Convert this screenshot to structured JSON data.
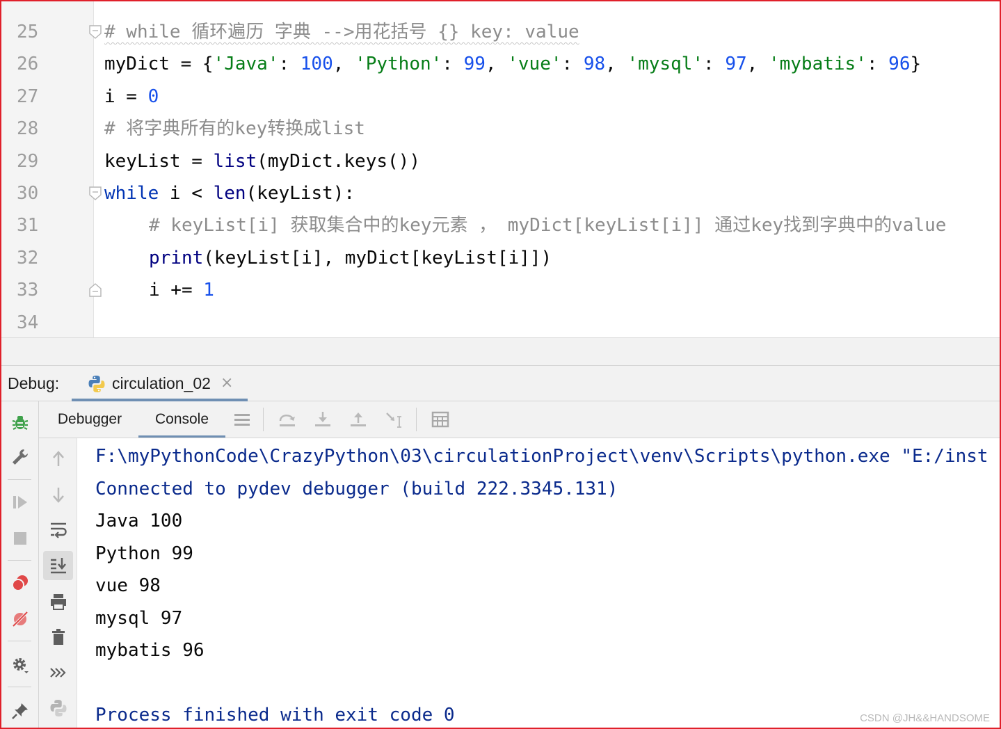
{
  "editor": {
    "lines": [
      {
        "no": "25",
        "indent": 0,
        "fold": "open",
        "tokens": [
          {
            "t": "# while 循环遍历 字典 -->用花括号 {} key: value",
            "c": "cm cmt-under"
          }
        ]
      },
      {
        "no": "26",
        "indent": 0,
        "tokens": [
          {
            "t": "myDict = {"
          },
          {
            "t": "'Java'",
            "c": "st"
          },
          {
            "t": ": "
          },
          {
            "t": "100",
            "c": "nm"
          },
          {
            "t": ", "
          },
          {
            "t": "'Python'",
            "c": "st"
          },
          {
            "t": ": "
          },
          {
            "t": "99",
            "c": "nm"
          },
          {
            "t": ", "
          },
          {
            "t": "'vue'",
            "c": "st"
          },
          {
            "t": ": "
          },
          {
            "t": "98",
            "c": "nm"
          },
          {
            "t": ", "
          },
          {
            "t": "'mysql'",
            "c": "st"
          },
          {
            "t": ": "
          },
          {
            "t": "97",
            "c": "nm"
          },
          {
            "t": ", "
          },
          {
            "t": "'mybatis'",
            "c": "st"
          },
          {
            "t": ": "
          },
          {
            "t": "96",
            "c": "nm"
          },
          {
            "t": "}"
          }
        ]
      },
      {
        "no": "27",
        "indent": 0,
        "tokens": [
          {
            "t": "i = "
          },
          {
            "t": "0",
            "c": "nm"
          }
        ]
      },
      {
        "no": "28",
        "indent": 0,
        "tokens": [
          {
            "t": "# 将字典所有的key转换成list",
            "c": "cm"
          }
        ]
      },
      {
        "no": "29",
        "indent": 0,
        "tokens": [
          {
            "t": "keyList = "
          },
          {
            "t": "list",
            "c": "bi"
          },
          {
            "t": "(myDict.keys())"
          }
        ]
      },
      {
        "no": "30",
        "indent": 0,
        "fold": "open",
        "tokens": [
          {
            "t": "while",
            "c": "kw"
          },
          {
            "t": " i < "
          },
          {
            "t": "len",
            "c": "bi"
          },
          {
            "t": "(keyList):"
          }
        ]
      },
      {
        "no": "31",
        "indent": 1,
        "tokens": [
          {
            "t": "# keyList[i] 获取集合中的key元素 ， myDict[keyList[i]] 通过key找到字典中的value",
            "c": "cm"
          }
        ]
      },
      {
        "no": "32",
        "indent": 1,
        "tokens": [
          {
            "t": "print",
            "c": "bi"
          },
          {
            "t": "(keyList[i], myDict[keyList[i]])"
          }
        ]
      },
      {
        "no": "33",
        "indent": 1,
        "fold": "end",
        "tokens": [
          {
            "t": "i += "
          },
          {
            "t": "1",
            "c": "nm"
          }
        ]
      },
      {
        "no": "34",
        "indent": 0,
        "tokens": []
      }
    ]
  },
  "debug": {
    "label": "Debug:",
    "run_tab": {
      "name": "circulation_02",
      "close": "×"
    },
    "tabs": [
      "Debugger",
      "Console"
    ],
    "active_tab": "Console"
  },
  "console": {
    "lines": [
      {
        "text": "F:\\myPythonCode\\CrazyPython\\03\\circulationProject\\venv\\Scripts\\python.exe \"E:/inst",
        "sys": true
      },
      {
        "text": "Connected to pydev debugger (build 222.3345.131)",
        "sys": true
      },
      {
        "text": "Java 100",
        "sys": false
      },
      {
        "text": "Python 99",
        "sys": false
      },
      {
        "text": "vue 98",
        "sys": false
      },
      {
        "text": "mysql 97",
        "sys": false
      },
      {
        "text": "mybatis 96",
        "sys": false
      },
      {
        "text": "",
        "sys": false
      },
      {
        "text": "Process finished with exit code 0",
        "sys": true
      }
    ]
  },
  "watermark": "CSDN @JH&&HANDSOME",
  "colors": {
    "keyword": "#0033b3",
    "builtin": "#000080",
    "string": "#067d17",
    "number": "#1750eb",
    "comment": "#8c8c8c",
    "console_system": "#0a2a8c",
    "frame_border": "#e0202a",
    "debug_icon": "#3fa14b",
    "breakpoint": "#e04848"
  },
  "icons": {
    "left_bar": [
      "bug-icon",
      "wrench-icon",
      "resume-icon",
      "stop-icon",
      "view-breakpoints-icon",
      "mute-breakpoints-icon",
      "settings-icon",
      "pin-icon"
    ],
    "console_tools": [
      "arrow-up-icon",
      "arrow-down-icon",
      "soft-wrap-icon",
      "scroll-to-end-icon",
      "print-icon",
      "trash-icon",
      "more-icon",
      "python-console-icon"
    ],
    "sub_toolbar": [
      "threads-icon",
      "step-over-icon",
      "step-into-icon",
      "step-out-icon",
      "run-to-cursor-icon",
      "evaluate-icon"
    ]
  }
}
